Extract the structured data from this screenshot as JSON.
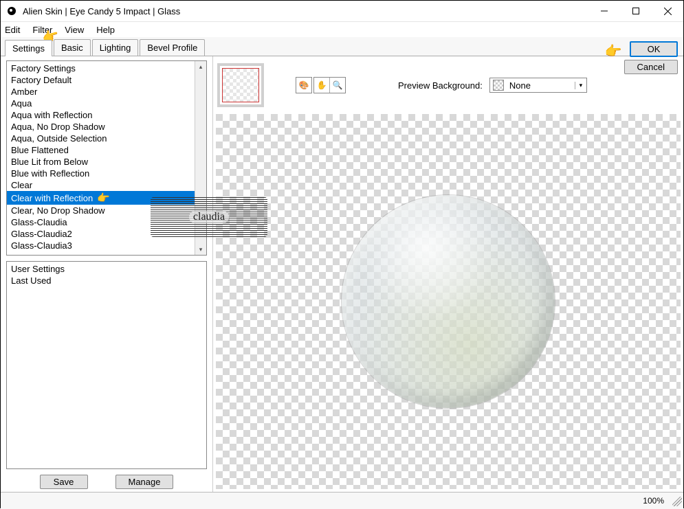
{
  "window": {
    "title": "Alien Skin | Eye Candy 5 Impact | Glass"
  },
  "menu": [
    "Edit",
    "Filter",
    "View",
    "Help"
  ],
  "tabs": [
    "Settings",
    "Basic",
    "Lighting",
    "Bevel Profile"
  ],
  "active_tab": "Settings",
  "factory_list": {
    "header": "Factory Settings",
    "items": [
      "Factory Default",
      "Amber",
      "Aqua",
      "Aqua with Reflection",
      "Aqua, No Drop Shadow",
      "Aqua, Outside Selection",
      "Blue Flattened",
      "Blue Lit from Below",
      "Blue with Reflection",
      "Clear",
      "Clear with Reflection",
      "Clear, No Drop Shadow",
      "Glass-Claudia",
      "Glass-Claudia2",
      "Glass-Claudia3"
    ],
    "selected_index": 10
  },
  "user_list": {
    "header": "User Settings",
    "items": [
      "Last Used"
    ]
  },
  "buttons": {
    "save": "Save",
    "manage": "Manage",
    "ok": "OK",
    "cancel": "Cancel"
  },
  "preview": {
    "label": "Preview Background:",
    "value": "None"
  },
  "watermark": "claudia",
  "status": {
    "zoom": "100%"
  },
  "icons": {
    "tool1": "🎨",
    "hand": "✋",
    "zoom": "🔍",
    "pointer": "👉"
  }
}
